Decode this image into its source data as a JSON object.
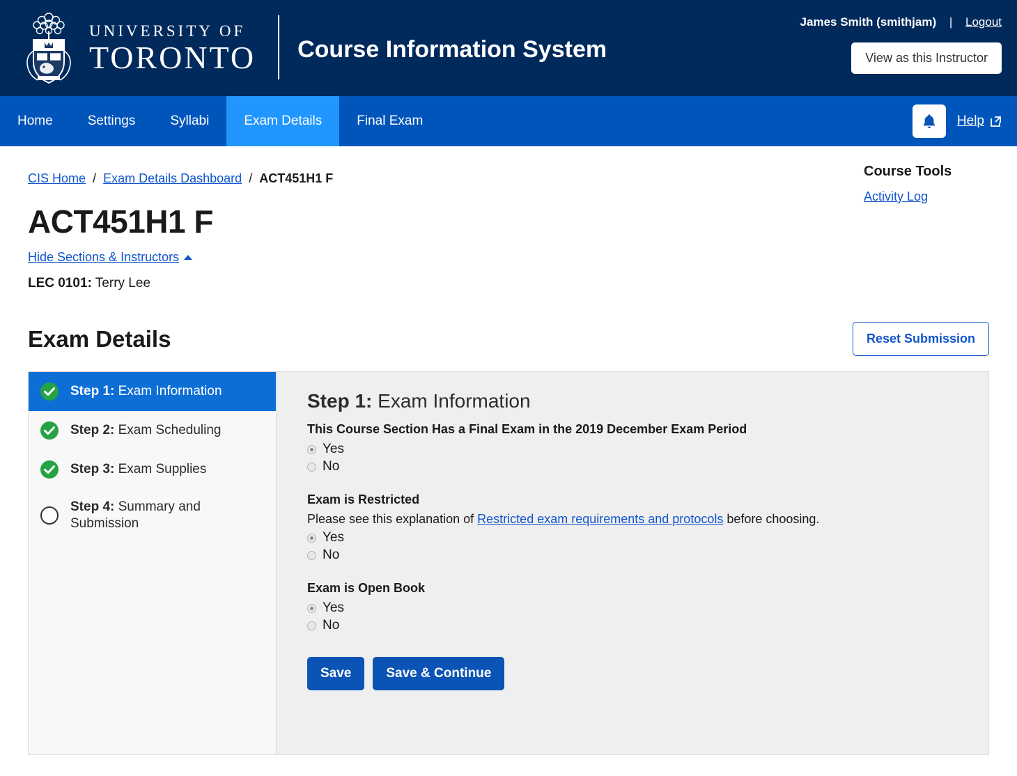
{
  "header": {
    "logo_line1": "UNIVERSITY OF",
    "logo_line2": "TORONTO",
    "app_title": "Course Information System",
    "user_name": "James Smith (smithjam)",
    "separator": "|",
    "logout_label": "Logout",
    "view_as_label": "View as this Instructor"
  },
  "nav": {
    "items": [
      {
        "label": "Home",
        "active": false
      },
      {
        "label": "Settings",
        "active": false
      },
      {
        "label": "Syllabi",
        "active": false
      },
      {
        "label": "Exam Details",
        "active": true
      },
      {
        "label": "Final Exam",
        "active": false
      }
    ],
    "help_label": "Help",
    "bell_icon": "bell-icon",
    "external_icon": "external-link-icon"
  },
  "breadcrumb": {
    "items": [
      {
        "label": "CIS Home",
        "link": true
      },
      {
        "label": "Exam Details Dashboard",
        "link": true
      },
      {
        "label": "ACT451H1 F",
        "link": false
      }
    ],
    "separator": "/"
  },
  "course_tools": {
    "heading": "Course Tools",
    "links": [
      "Activity Log"
    ]
  },
  "course": {
    "code": "ACT451H1 F",
    "toggle_label": "Hide Sections & Instructors",
    "section_code": "LEC 0101:",
    "section_instructor": " Terry Lee"
  },
  "exam_details": {
    "title": "Exam Details",
    "reset_label": "Reset Submission"
  },
  "steps": [
    {
      "num": "Step 1:",
      "name": " Exam Information",
      "state": "complete",
      "current": true
    },
    {
      "num": "Step 2:",
      "name": " Exam Scheduling",
      "state": "complete",
      "current": false
    },
    {
      "num": "Step 3:",
      "name": " Exam Supplies",
      "state": "complete",
      "current": false
    },
    {
      "num": "Step 4:",
      "name": " Summary and Submission",
      "state": "incomplete",
      "current": false
    }
  ],
  "panel": {
    "step_num": "Step 1:",
    "step_name": " Exam Information",
    "questions": [
      {
        "label": "This Course Section Has a Final Exam in the 2019 December Exam Period",
        "help_before": "",
        "help_link": "",
        "help_after": "",
        "options": [
          {
            "label": "Yes",
            "checked": true
          },
          {
            "label": "No",
            "checked": false
          }
        ]
      },
      {
        "label": "Exam is Restricted",
        "help_before": "Please see this explanation of ",
        "help_link": "Restricted exam requirements and protocols",
        "help_after": " before choosing.",
        "options": [
          {
            "label": "Yes",
            "checked": true
          },
          {
            "label": "No",
            "checked": false
          }
        ]
      },
      {
        "label": "Exam is Open Book",
        "help_before": "",
        "help_link": "",
        "help_after": "",
        "options": [
          {
            "label": "Yes",
            "checked": true
          },
          {
            "label": "No",
            "checked": false
          }
        ]
      }
    ],
    "save_label": "Save",
    "save_continue_label": "Save & Continue"
  },
  "colors": {
    "header_navy": "#002a5c",
    "nav_blue": "#0055bb",
    "nav_active_blue": "#2196ff",
    "link_blue": "#1155cc",
    "button_blue": "#0b54b5",
    "step_active_blue": "#0d6fd6",
    "check_green": "#25a244",
    "panel_gray": "#efefef",
    "steps_gray": "#f8f8f8"
  }
}
